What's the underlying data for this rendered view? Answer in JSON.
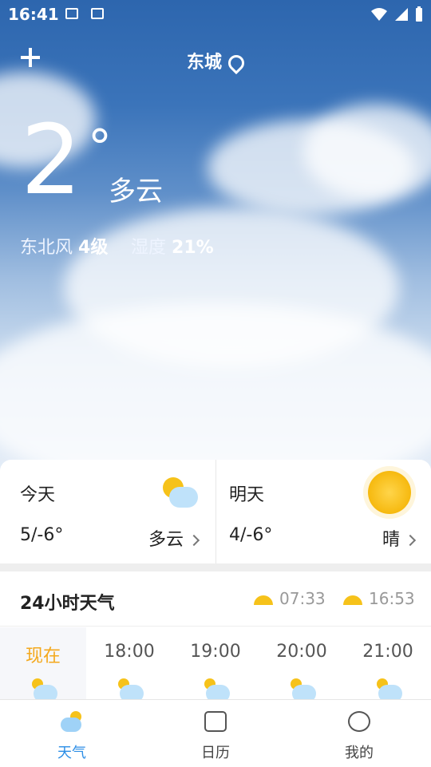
{
  "status_bar": {
    "time": "16:41",
    "icons_left": [
      "image-icon",
      "text-icon"
    ],
    "icons_right": [
      "wifi-icon",
      "signal-icon",
      "battery-icon"
    ]
  },
  "header": {
    "city": "东城",
    "add_icon": "plus-icon",
    "location_icon": "location-pin-icon"
  },
  "current": {
    "temperature": "2",
    "degree_symbol": "°",
    "condition": "多云",
    "wind_label": "东北风",
    "wind_value": "4级",
    "humidity_label": "湿度",
    "humidity_value": "21%"
  },
  "forecast": {
    "today": {
      "label": "今天",
      "range": "5/-6°",
      "condition": "多云",
      "icon": "partly-cloudy-icon"
    },
    "tomorrow": {
      "label": "明天",
      "range": "4/-6°",
      "condition": "晴",
      "icon": "sunny-icon"
    }
  },
  "hourly": {
    "title": "24小时天气",
    "sunrise": "07:33",
    "sunset": "16:53",
    "hours": [
      {
        "label": "现在",
        "icon": "partly-cloudy-icon"
      },
      {
        "label": "18:00",
        "icon": "night-cloudy-icon"
      },
      {
        "label": "19:00",
        "icon": "night-cloudy-icon"
      },
      {
        "label": "20:00",
        "icon": "night-cloudy-icon"
      },
      {
        "label": "21:00",
        "icon": "night-cloudy-icon"
      }
    ]
  },
  "tabs": [
    {
      "label": "天气",
      "icon": "weather-icon",
      "active": true
    },
    {
      "label": "日历",
      "icon": "calendar-icon",
      "active": false
    },
    {
      "label": "我的",
      "icon": "profile-icon",
      "active": false
    }
  ],
  "colors": {
    "accent": "#2c8ee6",
    "now_highlight": "#f4a81c",
    "sun": "#f6c21a"
  }
}
